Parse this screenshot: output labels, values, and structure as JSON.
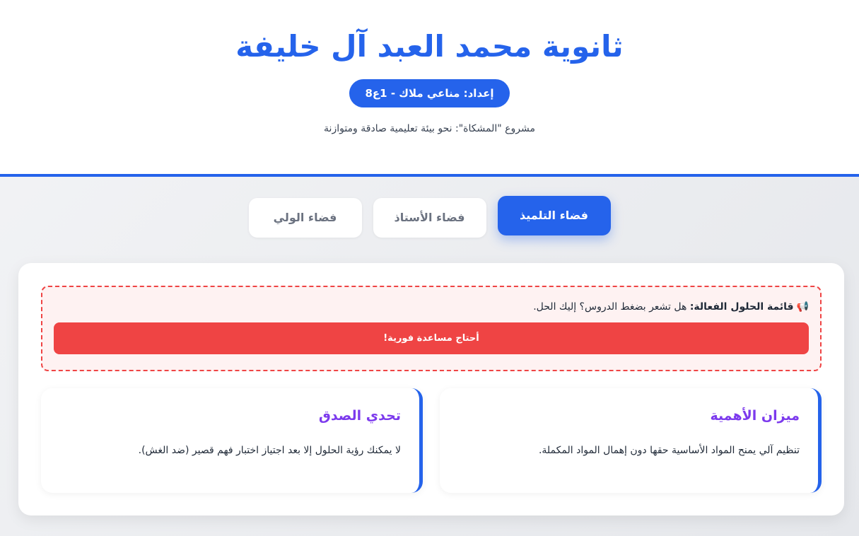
{
  "header": {
    "title": "ثانوية محمد العبد آل خليفة",
    "badge": "إعداد: مناعي ملاك - 1ع8",
    "subtitle": "مشروع \"المشكاة\": نحو بيئة تعليمية صادقة ومتوازنة"
  },
  "tabs": [
    {
      "label": "فضاء التلميذ",
      "active": true
    },
    {
      "label": "فضاء الأستاذ",
      "active": false
    },
    {
      "label": "فضاء الولي",
      "active": false
    }
  ],
  "alert": {
    "icon": "megaphone-icon",
    "strong": "قائمة الحلول الفعالة:",
    "text": "هل تشعر بضغط الدروس؟ إليك الحل.",
    "button_label": "أحتاج مساعدة فورية!"
  },
  "cards": [
    {
      "title": "ميزان الأهمية",
      "text": "تنظيم آلي يمنح المواد الأساسية حقها دون إهمال المواد المكملة."
    },
    {
      "title": "تحدي الصدق",
      "text": "لا يمكنك رؤية الحلول إلا بعد اجتياز اختبار فهم قصير (ضد الغش)."
    }
  ],
  "colors": {
    "primary": "#2563eb",
    "danger": "#ef4444",
    "card_title": "#7c3aed"
  }
}
